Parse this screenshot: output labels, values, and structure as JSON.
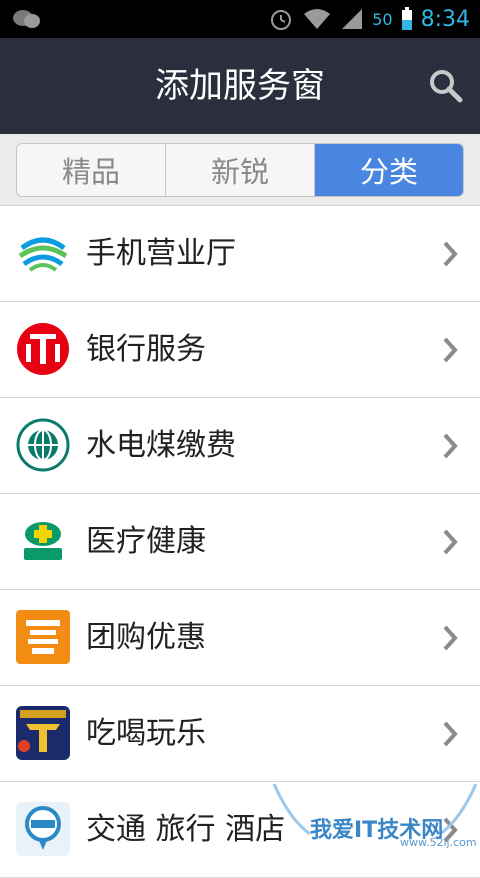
{
  "status_bar": {
    "battery": "50",
    "time": "8:34"
  },
  "header": {
    "title": "添加服务窗"
  },
  "tabs": [
    {
      "label": "精品",
      "active": false
    },
    {
      "label": "新锐",
      "active": false
    },
    {
      "label": "分类",
      "active": true
    }
  ],
  "categories": [
    {
      "label": "手机营业厅",
      "icon": "china-mobile-logo"
    },
    {
      "label": "银行服务",
      "icon": "citic-bank-logo"
    },
    {
      "label": "水电煤缴费",
      "icon": "state-grid-logo"
    },
    {
      "label": "医疗健康",
      "icon": "pharmacy-logo"
    },
    {
      "label": "团购优惠",
      "icon": "group-buy-logo"
    },
    {
      "label": "吃喝玩乐",
      "icon": "cinema-logo"
    },
    {
      "label": "交通 旅行 酒店",
      "icon": "bus-logo"
    }
  ],
  "watermark": {
    "text": "我爱IT技术网",
    "sub": "www.52ij.com"
  },
  "colors": {
    "header_bg": "#2b2f3d",
    "active_tab": "#4a86e0",
    "status_accent": "#33b5e5"
  }
}
